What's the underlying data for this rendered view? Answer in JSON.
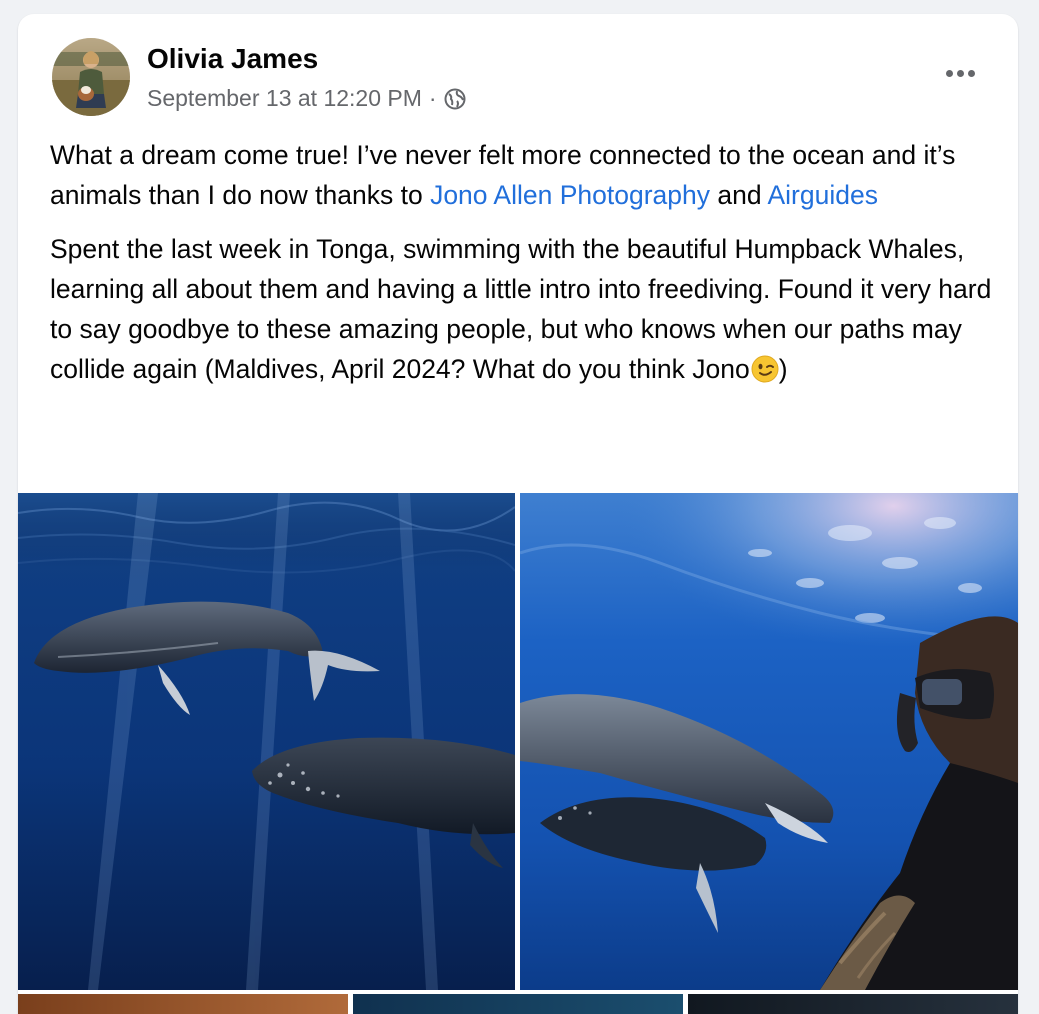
{
  "post": {
    "author": "Olivia James",
    "timestamp": "September 13 at 12:20 PM",
    "separator": "·",
    "privacy_icon": "globe-icon",
    "more_icon": "more-options-icon",
    "paragraph1": {
      "text_before": "What a dream come true! I’ve never felt more connected to the ocean and it’s animals than I do now thanks to ",
      "link1": "Jono Allen Photography",
      "text_between": " and ",
      "link2": "Airguides"
    },
    "paragraph2": {
      "text": "Spent the last week in Tonga, swimming with the beautiful Humpback Whales, learning all about them and having a little intro into freediving. Found it very hard to say goodbye to these amazing people, but who knows when our paths may collide again (Maldives, April 2024? What do you think Jono",
      "emoji": "winking-face-emoji",
      "text_after": ")"
    },
    "colors": {
      "link": "#216fdb",
      "secondary_text": "#65676b",
      "primary_text": "#050505",
      "page_background": "#f0f2f5",
      "card_background": "#ffffff"
    },
    "photos": [
      "whales-underwater-photo",
      "snorkeler-with-whales-photo"
    ]
  }
}
